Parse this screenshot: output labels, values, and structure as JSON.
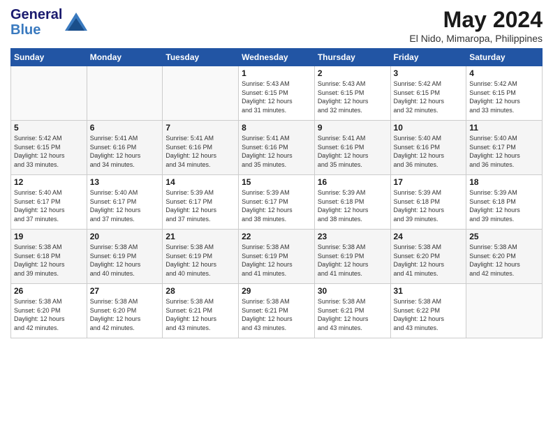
{
  "header": {
    "logo_line1": "General",
    "logo_line2": "Blue",
    "month_year": "May 2024",
    "location": "El Nido, Mimaropa, Philippines"
  },
  "weekdays": [
    "Sunday",
    "Monday",
    "Tuesday",
    "Wednesday",
    "Thursday",
    "Friday",
    "Saturday"
  ],
  "weeks": [
    [
      {
        "day": "",
        "info": ""
      },
      {
        "day": "",
        "info": ""
      },
      {
        "day": "",
        "info": ""
      },
      {
        "day": "1",
        "info": "Sunrise: 5:43 AM\nSunset: 6:15 PM\nDaylight: 12 hours\nand 31 minutes."
      },
      {
        "day": "2",
        "info": "Sunrise: 5:43 AM\nSunset: 6:15 PM\nDaylight: 12 hours\nand 32 minutes."
      },
      {
        "day": "3",
        "info": "Sunrise: 5:42 AM\nSunset: 6:15 PM\nDaylight: 12 hours\nand 32 minutes."
      },
      {
        "day": "4",
        "info": "Sunrise: 5:42 AM\nSunset: 6:15 PM\nDaylight: 12 hours\nand 33 minutes."
      }
    ],
    [
      {
        "day": "5",
        "info": "Sunrise: 5:42 AM\nSunset: 6:15 PM\nDaylight: 12 hours\nand 33 minutes."
      },
      {
        "day": "6",
        "info": "Sunrise: 5:41 AM\nSunset: 6:16 PM\nDaylight: 12 hours\nand 34 minutes."
      },
      {
        "day": "7",
        "info": "Sunrise: 5:41 AM\nSunset: 6:16 PM\nDaylight: 12 hours\nand 34 minutes."
      },
      {
        "day": "8",
        "info": "Sunrise: 5:41 AM\nSunset: 6:16 PM\nDaylight: 12 hours\nand 35 minutes."
      },
      {
        "day": "9",
        "info": "Sunrise: 5:41 AM\nSunset: 6:16 PM\nDaylight: 12 hours\nand 35 minutes."
      },
      {
        "day": "10",
        "info": "Sunrise: 5:40 AM\nSunset: 6:16 PM\nDaylight: 12 hours\nand 36 minutes."
      },
      {
        "day": "11",
        "info": "Sunrise: 5:40 AM\nSunset: 6:17 PM\nDaylight: 12 hours\nand 36 minutes."
      }
    ],
    [
      {
        "day": "12",
        "info": "Sunrise: 5:40 AM\nSunset: 6:17 PM\nDaylight: 12 hours\nand 37 minutes."
      },
      {
        "day": "13",
        "info": "Sunrise: 5:40 AM\nSunset: 6:17 PM\nDaylight: 12 hours\nand 37 minutes."
      },
      {
        "day": "14",
        "info": "Sunrise: 5:39 AM\nSunset: 6:17 PM\nDaylight: 12 hours\nand 37 minutes."
      },
      {
        "day": "15",
        "info": "Sunrise: 5:39 AM\nSunset: 6:17 PM\nDaylight: 12 hours\nand 38 minutes."
      },
      {
        "day": "16",
        "info": "Sunrise: 5:39 AM\nSunset: 6:18 PM\nDaylight: 12 hours\nand 38 minutes."
      },
      {
        "day": "17",
        "info": "Sunrise: 5:39 AM\nSunset: 6:18 PM\nDaylight: 12 hours\nand 39 minutes."
      },
      {
        "day": "18",
        "info": "Sunrise: 5:39 AM\nSunset: 6:18 PM\nDaylight: 12 hours\nand 39 minutes."
      }
    ],
    [
      {
        "day": "19",
        "info": "Sunrise: 5:38 AM\nSunset: 6:18 PM\nDaylight: 12 hours\nand 39 minutes."
      },
      {
        "day": "20",
        "info": "Sunrise: 5:38 AM\nSunset: 6:19 PM\nDaylight: 12 hours\nand 40 minutes."
      },
      {
        "day": "21",
        "info": "Sunrise: 5:38 AM\nSunset: 6:19 PM\nDaylight: 12 hours\nand 40 minutes."
      },
      {
        "day": "22",
        "info": "Sunrise: 5:38 AM\nSunset: 6:19 PM\nDaylight: 12 hours\nand 41 minutes."
      },
      {
        "day": "23",
        "info": "Sunrise: 5:38 AM\nSunset: 6:19 PM\nDaylight: 12 hours\nand 41 minutes."
      },
      {
        "day": "24",
        "info": "Sunrise: 5:38 AM\nSunset: 6:20 PM\nDaylight: 12 hours\nand 41 minutes."
      },
      {
        "day": "25",
        "info": "Sunrise: 5:38 AM\nSunset: 6:20 PM\nDaylight: 12 hours\nand 42 minutes."
      }
    ],
    [
      {
        "day": "26",
        "info": "Sunrise: 5:38 AM\nSunset: 6:20 PM\nDaylight: 12 hours\nand 42 minutes."
      },
      {
        "day": "27",
        "info": "Sunrise: 5:38 AM\nSunset: 6:20 PM\nDaylight: 12 hours\nand 42 minutes."
      },
      {
        "day": "28",
        "info": "Sunrise: 5:38 AM\nSunset: 6:21 PM\nDaylight: 12 hours\nand 43 minutes."
      },
      {
        "day": "29",
        "info": "Sunrise: 5:38 AM\nSunset: 6:21 PM\nDaylight: 12 hours\nand 43 minutes."
      },
      {
        "day": "30",
        "info": "Sunrise: 5:38 AM\nSunset: 6:21 PM\nDaylight: 12 hours\nand 43 minutes."
      },
      {
        "day": "31",
        "info": "Sunrise: 5:38 AM\nSunset: 6:22 PM\nDaylight: 12 hours\nand 43 minutes."
      },
      {
        "day": "",
        "info": ""
      }
    ]
  ]
}
